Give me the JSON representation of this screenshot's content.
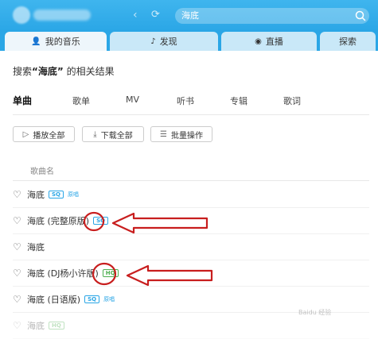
{
  "search": {
    "value": "海底"
  },
  "tabs": [
    {
      "label": "我的音乐",
      "icon": "user-icon"
    },
    {
      "label": "发现",
      "icon": "music-note-icon"
    },
    {
      "label": "直播",
      "icon": "live-icon"
    },
    {
      "label": "探索",
      "icon": ""
    }
  ],
  "heading": {
    "prefix": "搜索",
    "keyword": "“海底”",
    "suffix": "的相关结果"
  },
  "categories": [
    "单曲",
    "歌单",
    "MV",
    "听书",
    "专辑",
    "歌词"
  ],
  "actions": [
    {
      "label": "播放全部",
      "icon": "play-icon"
    },
    {
      "label": "下载全部",
      "icon": "download-icon"
    },
    {
      "label": "批量操作",
      "icon": "batch-icon"
    }
  ],
  "columns": {
    "song_name": "歌曲名"
  },
  "songs": [
    {
      "name": "海底",
      "badge": "SQ",
      "tag": "原唱"
    },
    {
      "name": "海底 (完整原版)",
      "badge": "SQ",
      "tag": ""
    },
    {
      "name": "海底",
      "badge": "",
      "tag": ""
    },
    {
      "name": "海底 (DJ杨小许版)",
      "badge": "HQ",
      "tag": ""
    },
    {
      "name": "海底 (日语版)",
      "badge": "SQ",
      "tag": "原唱"
    },
    {
      "name": "海底",
      "badge": "HQ",
      "tag": ""
    }
  ],
  "colors": {
    "accent": "#2aa6e6",
    "sq_badge": "#2aa6e6",
    "hq_badge": "#4caf50",
    "annotation": "#c81e1e"
  },
  "watermark": "Baidu 经验"
}
